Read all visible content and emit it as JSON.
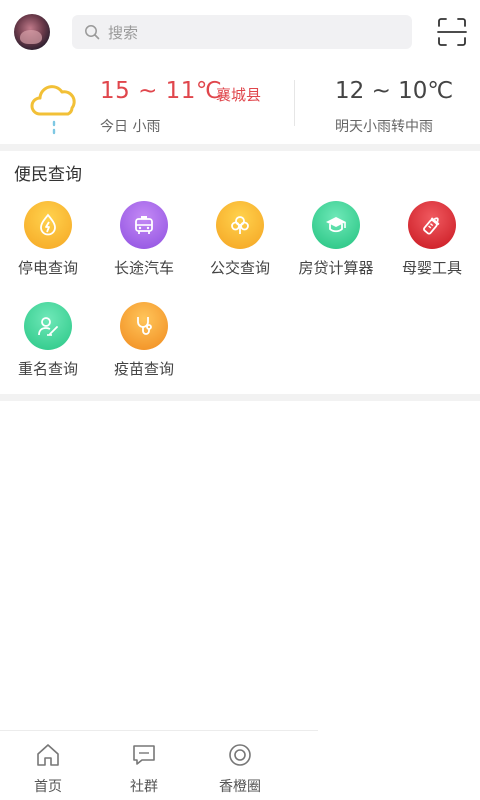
{
  "header": {
    "search_placeholder": "搜索"
  },
  "weather": {
    "today_temp": "15 ~ 11℃",
    "city": "襄城县",
    "today_desc": "今日  小雨",
    "tomorrow_temp": "12 ~ 10℃",
    "tomorrow_desc": "明天小雨转中雨"
  },
  "services": {
    "title": "便民查询",
    "items": [
      {
        "label": "停电查询",
        "icon": "power-drop-icon",
        "color": "#f5a623"
      },
      {
        "label": "长途汽车",
        "icon": "bus-icon",
        "color": "#9b59e6"
      },
      {
        "label": "公交查询",
        "icon": "tree-icon",
        "color": "#f4a322"
      },
      {
        "label": "房贷计算器",
        "icon": "graduation-cap-icon",
        "color": "#2fcf8e"
      },
      {
        "label": "母婴工具",
        "icon": "baby-bottle-icon",
        "color": "#e2242f"
      },
      {
        "label": "重名查询",
        "icon": "person-edit-icon",
        "color": "#35cf8f"
      },
      {
        "label": "疫苗查询",
        "icon": "stethoscope-icon",
        "color": "#f5a01f"
      }
    ]
  },
  "nav": {
    "home": "首页",
    "community": "社群",
    "circle": "香橙圈"
  }
}
